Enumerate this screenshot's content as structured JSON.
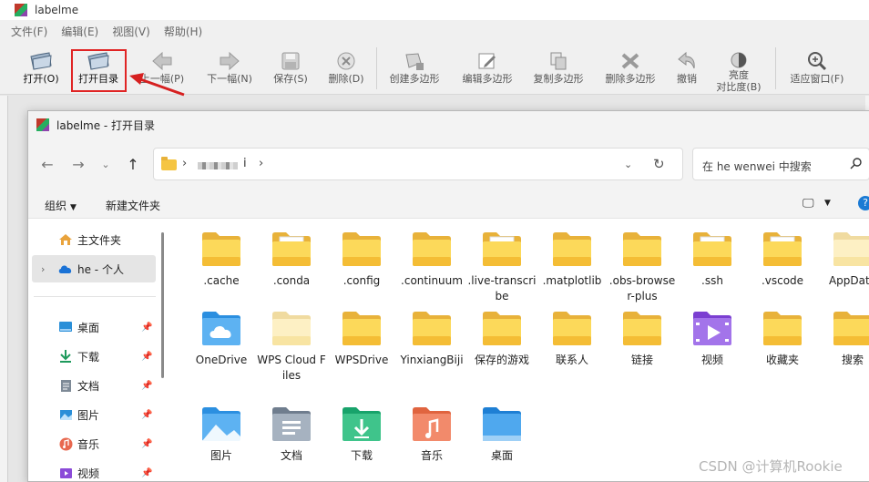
{
  "app": {
    "title": "labelme"
  },
  "menu": [
    "文件(F)",
    "编辑(E)",
    "视图(V)",
    "帮助(H)"
  ],
  "toolbar": {
    "open": "打开(O)",
    "open_dir": "打开目录",
    "prev": "上一幅(P)",
    "next": "下一幅(N)",
    "save": "保存(S)",
    "delete": "删除(D)",
    "create_polygon": "创建多边形",
    "edit_polygon": "编辑多边形",
    "copy_polygon": "复制多边形",
    "delete_polygon": "删除多边形",
    "undo": "撤销",
    "brightness_line1": "亮度",
    "brightness_line2": "对比度(B)",
    "fit_window": "适应窗口(F)"
  },
  "dialog": {
    "title": "labelme - 打开目录",
    "address_tail": "i",
    "search_placeholder": "在 he wenwei 中搜索",
    "organize": "组织",
    "new_folder": "新建文件夹",
    "help": "?"
  },
  "sidebar": [
    {
      "label": "主文件夹",
      "icon": "home-icon",
      "pinned": false
    },
    {
      "label": "he - 个人",
      "icon": "onedrive-cloud-icon",
      "pinned": false,
      "selected": true
    },
    {
      "label": "桌面",
      "icon": "desktop-icon",
      "pinned": true
    },
    {
      "label": "下载",
      "icon": "download-icon",
      "pinned": true
    },
    {
      "label": "文档",
      "icon": "document-icon",
      "pinned": true
    },
    {
      "label": "图片",
      "icon": "picture-icon",
      "pinned": true
    },
    {
      "label": "音乐",
      "icon": "music-icon",
      "pinned": true
    },
    {
      "label": "视频",
      "icon": "video-icon",
      "pinned": true
    }
  ],
  "files": [
    {
      "name": ".cache",
      "icon": "folder-icon"
    },
    {
      "name": ".conda",
      "icon": "folder-icon"
    },
    {
      "name": ".config",
      "icon": "folder-icon"
    },
    {
      "name": ".continuum",
      "icon": "folder-icon"
    },
    {
      "name": ".live-transcribe",
      "icon": "folder-icon"
    },
    {
      "name": ".matplotlib",
      "icon": "folder-icon"
    },
    {
      "name": ".obs-browser-plus",
      "icon": "folder-icon"
    },
    {
      "name": ".ssh",
      "icon": "folder-icon"
    },
    {
      "name": ".vscode",
      "icon": "folder-icon"
    },
    {
      "name": "AppData",
      "icon": "folder-icon"
    },
    {
      "name": "OneDrive",
      "icon": "onedrive-folder-icon"
    },
    {
      "name": "WPS Cloud Files",
      "icon": "folder-icon"
    },
    {
      "name": "WPSDrive",
      "icon": "folder-icon"
    },
    {
      "name": "YinxiangBiji",
      "icon": "folder-icon"
    },
    {
      "name": "保存的游戏",
      "icon": "folder-icon"
    },
    {
      "name": "联系人",
      "icon": "folder-icon"
    },
    {
      "name": "链接",
      "icon": "folder-icon"
    },
    {
      "name": "视频",
      "icon": "video-folder-icon"
    },
    {
      "name": "收藏夹",
      "icon": "folder-icon"
    },
    {
      "name": "搜索",
      "icon": "folder-icon"
    },
    {
      "name": "图片",
      "icon": "pictures-folder-icon"
    },
    {
      "name": "文档",
      "icon": "documents-folder-icon"
    },
    {
      "name": "下载",
      "icon": "downloads-folder-icon"
    },
    {
      "name": "音乐",
      "icon": "music-folder-icon"
    },
    {
      "name": "桌面",
      "icon": "desktop-folder-icon"
    }
  ],
  "watermark": "CSDN @计算机Rookie"
}
